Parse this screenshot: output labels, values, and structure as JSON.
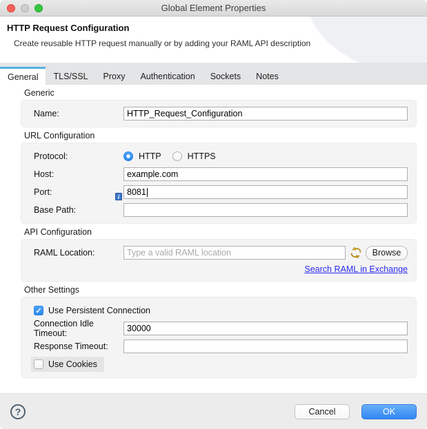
{
  "window": {
    "title": "Global Element Properties"
  },
  "header": {
    "title": "HTTP Request Configuration",
    "subtitle": "Create reusable HTTP request manually or by adding your RAML API description"
  },
  "tabs": [
    {
      "label": "General",
      "selected": true
    },
    {
      "label": "TLS/SSL",
      "selected": false
    },
    {
      "label": "Proxy",
      "selected": false
    },
    {
      "label": "Authentication",
      "selected": false
    },
    {
      "label": "Sockets",
      "selected": false
    },
    {
      "label": "Notes",
      "selected": false
    }
  ],
  "generic": {
    "title": "Generic",
    "name_label": "Name:",
    "name_value": "HTTP_Request_Configuration"
  },
  "url_configuration": {
    "title": "URL Configuration",
    "protocol_label": "Protocol:",
    "protocol_http": "HTTP",
    "protocol_https": "HTTPS",
    "protocol_selected": "HTTP",
    "host_label": "Host:",
    "host_value": "example.com",
    "port_label": "Port:",
    "port_value": "8081",
    "base_path_label": "Base Path:",
    "base_path_value": ""
  },
  "api_configuration": {
    "title": "API Configuration",
    "raml_label": "RAML Location:",
    "raml_placeholder": "Type a valid RAML location",
    "raml_value": "",
    "browse_button": "Browse",
    "exchange_link": "Search RAML in Exchange"
  },
  "other_settings": {
    "title": "Other Settings",
    "use_persistent_connection": {
      "label": "Use Persistent Connection",
      "checked": true
    },
    "connection_idle_timeout_label": "Connection Idle Timeout:",
    "connection_idle_timeout_value": "30000",
    "response_timeout_label": "Response Timeout:",
    "response_timeout_value": "",
    "use_cookies": {
      "label": "Use Cookies",
      "checked": false
    }
  },
  "footer": {
    "help": "?",
    "cancel_button": "Cancel",
    "ok_button": "OK",
    "checkmark_glyph": "✓"
  },
  "colors": {
    "accent_blue": "#3b99fc",
    "tab_accent": "#54b1e1",
    "link_blue": "#2a2aee",
    "ok_button_top": "#67aff8",
    "ok_button_bottom": "#3187f3",
    "groupbox_bg": "#f4f4f5",
    "footer_bg": "#ececec",
    "sync_icon_gold": "#d9a520",
    "traffic_red": "#f7605a",
    "traffic_gray": "#cdcdcd",
    "traffic_green": "#34c83e"
  }
}
